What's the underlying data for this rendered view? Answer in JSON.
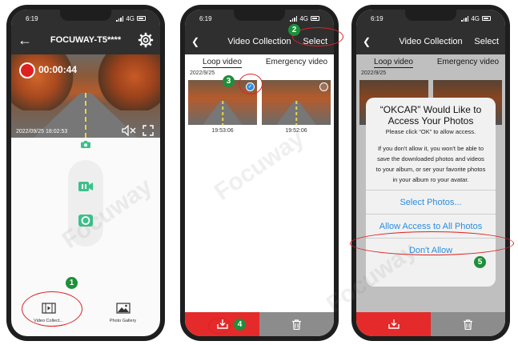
{
  "status": {
    "time": "6:19",
    "network": "4G"
  },
  "phone1": {
    "title": "FOCUWAY-T5****",
    "rec_time": "00:00:44",
    "timestamp": "2022/09/25 18:02:53",
    "tab_video": "Video Collect...",
    "tab_photo": "Photo Gallery"
  },
  "phone2": {
    "title": "Video Collection",
    "select": "Select",
    "tab_loop": "Loop video",
    "tab_emergency": "Emergency video",
    "date": "2022/9/25",
    "thumb1_time": "19:53:06",
    "thumb2_time": "19:52:06"
  },
  "phone3": {
    "title": "Video Collection",
    "select": "Select",
    "tab_loop": "Loop video",
    "tab_emergency": "Emergency video",
    "date": "2022/9/25",
    "dialog_title": "“OKCAR” Would Like to Access Your Photos",
    "dialog_sub": "Please click “OK” to allow access.",
    "dialog_body": "If you don't allow it, you won't be able to save the downloaded photos and videos to your album, or ser your favorite photos in your album ro your avatar.",
    "btn_select": "Select Photos...",
    "btn_allow": "Allow Access to All Photos",
    "btn_deny": "Don't Allow"
  },
  "badges": [
    "1",
    "2",
    "3",
    "4",
    "5"
  ],
  "watermark": "Focuway",
  "colors": {
    "accent_red": "#e42a2a",
    "badge_green": "#1e8f3a",
    "ios_blue": "#2a8de0",
    "header_dark": "#2f2f2f"
  }
}
